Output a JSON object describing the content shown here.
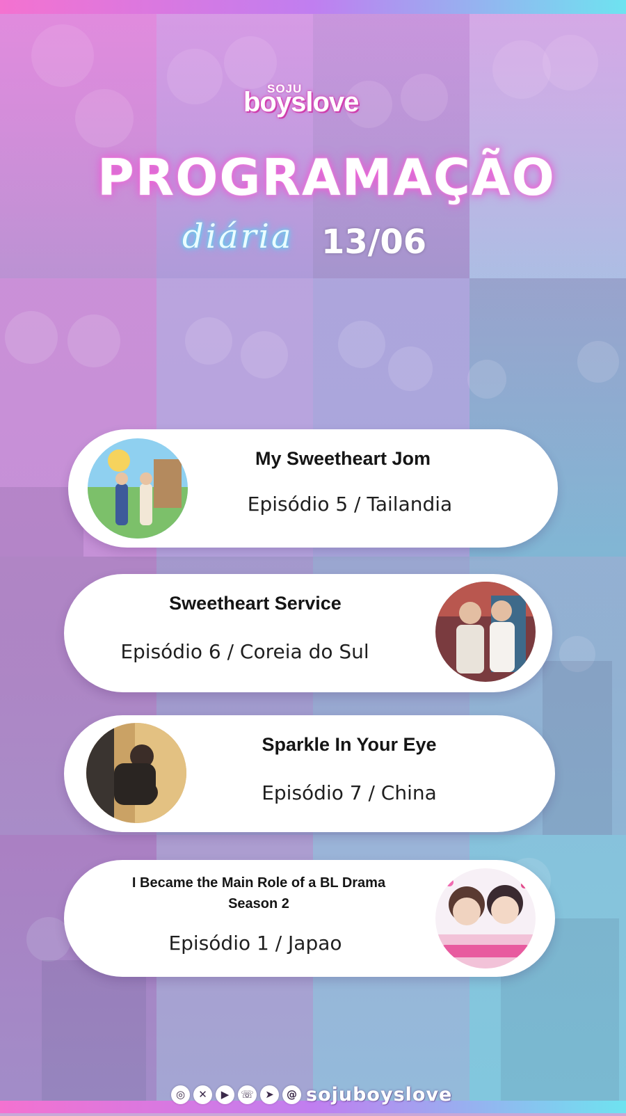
{
  "header": {
    "brand_top": "SOJU",
    "brand": "boyslove",
    "title": "PROGRAMAÇÃO",
    "subtitle": "diária",
    "date": "13/06"
  },
  "schedule": [
    {
      "title": "My Sweetheart Jom",
      "episode": "Episódio 5 / Tailandia"
    },
    {
      "title": "Sweetheart Service",
      "episode": "Episódio 6 / Coreia do Sul"
    },
    {
      "title": "Sparkle In Your Eye",
      "episode": "Episódio 7 / China"
    },
    {
      "title": "I Became the Main Role of a BL Drama\nSeason 2",
      "title_line1": "I Became the Main Role of a BL Drama",
      "title_line2": "Season 2",
      "episode": "Episódio 1 / Japao"
    }
  ],
  "footer": {
    "icons": [
      "instagram-icon",
      "x-icon",
      "youtube-icon",
      "whatsapp-icon",
      "telegram-icon",
      "threads-icon"
    ],
    "handle": "sojuboyslove"
  },
  "colors": {
    "accent_pink": "#f06ad6",
    "accent_cyan": "#4fe0ee",
    "card_bg": "#ffffff"
  }
}
